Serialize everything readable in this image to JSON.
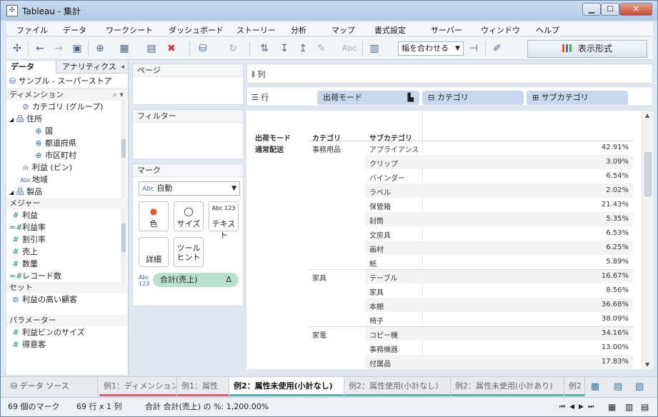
{
  "window": {
    "title": "Tableau - 集計",
    "min": "▁",
    "max": "☐",
    "close": "✕"
  },
  "menu": [
    "ファイル",
    "データ",
    "ワークシート",
    "ダッシュボード",
    "ストーリー",
    "分析",
    "マップ",
    "書式設定",
    "サーバー",
    "ウィンドウ",
    "ヘルプ"
  ],
  "toolbar": {
    "fit": "幅を合わせる",
    "showme": "表示形式",
    "abc": "Abc"
  },
  "leftpane": {
    "tab_data": "データ",
    "tab_analytics": "アナリティクス",
    "datasource": "サンプル - スーパーストア",
    "dim_head": "ディメンション",
    "dimensions": [
      {
        "icon": "paperclip-icon",
        "glyph": "⊘",
        "label": "カテゴリ (グループ)"
      },
      {
        "icon": "hierarchy-icon",
        "glyph": "品",
        "label": "住所"
      },
      {
        "icon": "globe-icon",
        "glyph": "⊕",
        "label": "国"
      },
      {
        "icon": "globe-icon",
        "glyph": "⊕",
        "label": "都道府県"
      },
      {
        "icon": "globe-icon",
        "glyph": "⊕",
        "label": "市区町村"
      },
      {
        "icon": "bin-icon",
        "glyph": "ılı",
        "label": "利益 (ビン)"
      },
      {
        "icon": "abc-icon",
        "glyph": "Abc",
        "label": "地域"
      },
      {
        "icon": "hierarchy-icon",
        "glyph": "品",
        "label": "製品"
      }
    ],
    "meas_head": "メジャー",
    "measures": [
      {
        "icon": "measure-icon",
        "label": "利益"
      },
      {
        "icon": "calc-measure-icon",
        "label": "利益率"
      },
      {
        "icon": "measure-icon",
        "label": "割引率"
      },
      {
        "icon": "measure-icon",
        "label": "売上"
      },
      {
        "icon": "measure-icon",
        "label": "数量"
      },
      {
        "icon": "calc-measure-icon",
        "label": "レコード数"
      }
    ],
    "set_head": "セット",
    "sets": [
      {
        "icon": "set-icon",
        "label": "利益の高い顧客"
      }
    ],
    "param_head": "パラメーター",
    "params": [
      {
        "icon": "measure-icon",
        "label": "利益ビンのサイズ"
      },
      {
        "icon": "measure-icon",
        "label": "得意客"
      }
    ]
  },
  "cards": {
    "pages": "ページ",
    "filters": "フィルター",
    "marks": "マーク",
    "marktype_icon": "Abc",
    "marktype": "自動",
    "btn_color": "色",
    "btn_size": "サイズ",
    "btn_text": "テキスト",
    "btn_text_icon": "Abc 123",
    "btn_detail": "詳細",
    "btn_tooltip": "ツール ヒント",
    "sum_icon": "Abc 123",
    "sum_pill": "合計(売上)",
    "delta": "Δ"
  },
  "shelves": {
    "columns_label": "列",
    "rows_label": "行",
    "pills": [
      "出荷モード",
      "カテゴリ",
      "サブカテゴリ"
    ]
  },
  "view": {
    "headers": [
      "出荷モード",
      "カテゴリ",
      "サブカテゴリ"
    ],
    "ship_mode": "通常配送",
    "rows": [
      {
        "cat": "事務用品",
        "sub": "アプライアンス",
        "val": "42.91%"
      },
      {
        "cat": "",
        "sub": "クリップ",
        "val": "3.09%"
      },
      {
        "cat": "",
        "sub": "バインダー",
        "val": "6.54%"
      },
      {
        "cat": "",
        "sub": "ラベル",
        "val": "2.02%"
      },
      {
        "cat": "",
        "sub": "保管箱",
        "val": "21.43%"
      },
      {
        "cat": "",
        "sub": "封筒",
        "val": "5.35%"
      },
      {
        "cat": "",
        "sub": "文房具",
        "val": "6.53%"
      },
      {
        "cat": "",
        "sub": "画材",
        "val": "6.25%"
      },
      {
        "cat": "",
        "sub": "紙",
        "val": "5.89%"
      },
      {
        "cat": "家具",
        "sub": "テーブル",
        "val": "16.67%"
      },
      {
        "cat": "",
        "sub": "家具",
        "val": "8.56%"
      },
      {
        "cat": "",
        "sub": "本棚",
        "val": "36.68%"
      },
      {
        "cat": "",
        "sub": "椅子",
        "val": "38.09%"
      },
      {
        "cat": "家電",
        "sub": "コピー機",
        "val": "34.16%"
      },
      {
        "cat": "",
        "sub": "事務機器",
        "val": "13.00%"
      },
      {
        "cat": "",
        "sub": "付属品",
        "val": "17.83%"
      }
    ]
  },
  "sheettabs": {
    "datasource": "データ ソース",
    "tabs": [
      {
        "label": "例1：ディメンション",
        "color": "#e05a78"
      },
      {
        "label": "例1：属性",
        "color": "#e05a78"
      },
      {
        "label": "例2：属性未使用(小計なし)",
        "color": "#4fb0a5"
      },
      {
        "label": "例2：属性使用(小計なし)",
        "color": "#4fb0a5"
      },
      {
        "label": "例2：属性未使用(小計あり)",
        "color": "#4fb0a5"
      },
      {
        "label": "例2",
        "color": "#4fb0a5"
      }
    ]
  },
  "status": {
    "marks": "69 個のマーク",
    "dims": "69 行 x 1 列",
    "sum": "合計 合計(売上) の %: 1,200.00%"
  }
}
